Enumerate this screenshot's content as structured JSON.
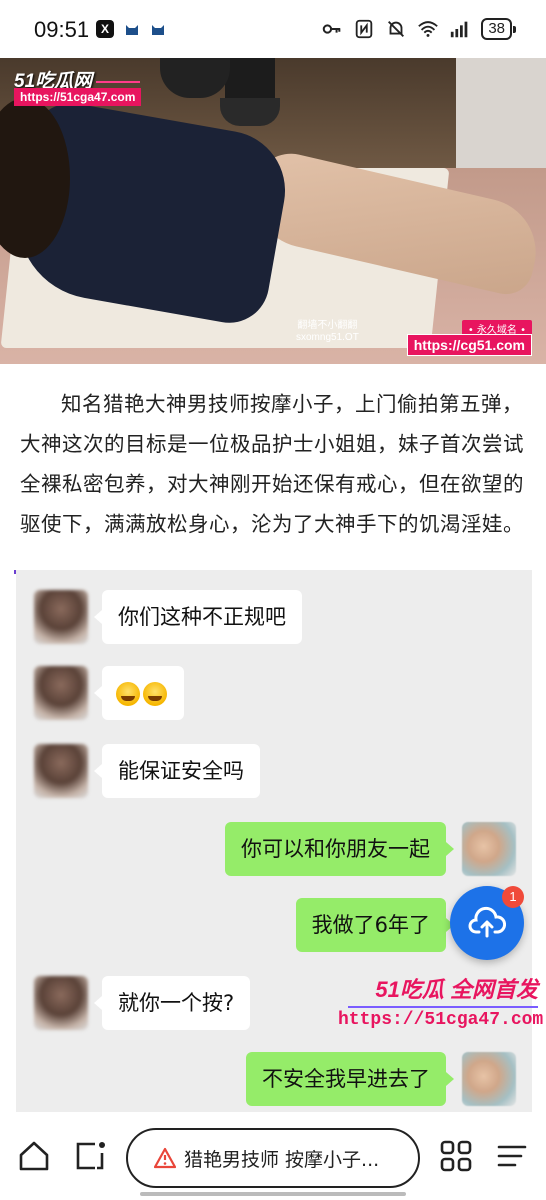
{
  "status_bar": {
    "time": "09:51",
    "x_app_label": "X",
    "battery": "38",
    "icons": [
      "x-app-icon",
      "cat-icon",
      "cat-icon",
      "key-icon",
      "nfc-icon",
      "mute-bell-icon",
      "wifi-icon",
      "signal-icon",
      "battery-icon"
    ]
  },
  "hero": {
    "logo": "51吃瓜网",
    "url_tag": "https://51cga47.com",
    "subtitle_line1": "翻墙不小翻翻",
    "subtitle_line2": "sxomng51.OT",
    "perm_label": "• 永久域名 •",
    "perm_url": "https://cg51.com"
  },
  "article": {
    "paragraph": "知名猎艳大神男技师按摩小子，上门偷拍第五弹，大神这次的目标是一位极品护士小姐姐，妹子首次尝试全裸私密包养，对大神刚开始还保有戒心，但在欲望的驱使下，满满放松身心，沦为了大神手下的饥渴淫娃。"
  },
  "chat": {
    "messages": [
      {
        "side": "left",
        "text": "你们这种不正规吧"
      },
      {
        "side": "left",
        "text": "",
        "emoji": true
      },
      {
        "side": "left",
        "text": "能保证安全吗"
      },
      {
        "side": "right",
        "text": "你可以和你朋友一起"
      },
      {
        "side": "right",
        "text": "我做了6年了"
      },
      {
        "side": "left",
        "text": "就你一个按?"
      },
      {
        "side": "right",
        "text": "不安全我早进去了"
      }
    ],
    "watermark_top": "51吃瓜 全网首发",
    "watermark_url": "https://51cga47.com"
  },
  "fab": {
    "icon": "cloud-upload-icon",
    "badge": "1",
    "color": "#1d72e8"
  },
  "bottom_bar": {
    "address_text": "猎艳男技师 按摩小子...",
    "icons": [
      "home-icon",
      "tabs-switch-icon",
      "warning-icon",
      "apps-grid-icon",
      "menu-icon"
    ]
  },
  "colors": {
    "wechat_green": "#95ec69",
    "watermark_pink": "#e8155f",
    "warning_red": "#e9463a"
  }
}
